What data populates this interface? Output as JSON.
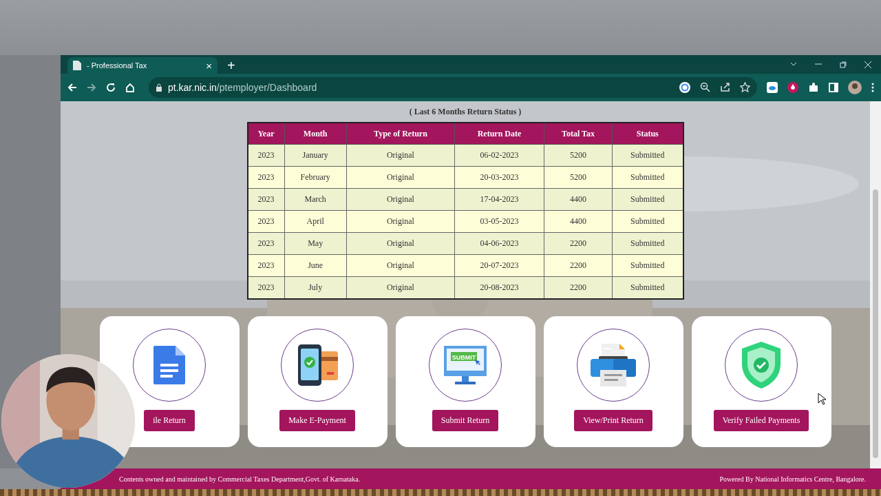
{
  "browser": {
    "tab": {
      "title": "- Professional Tax",
      "close": "×"
    },
    "new_tab": "+",
    "address": {
      "host": "pt.kar.nic.in",
      "path": "/ptemployer/Dashboard"
    }
  },
  "page": {
    "caption": "( Last 6 Months Return Status )",
    "table": {
      "columns": [
        "Year",
        "Month",
        "Type of Return",
        "Return Date",
        "Total Tax",
        "Status"
      ],
      "rows": [
        [
          "2023",
          "January",
          "Original",
          "06-02-2023",
          "5200",
          "Submitted"
        ],
        [
          "2023",
          "February",
          "Original",
          "20-03-2023",
          "5200",
          "Submitted"
        ],
        [
          "2023",
          "March",
          "Original",
          "17-04-2023",
          "4400",
          "Submitted"
        ],
        [
          "2023",
          "April",
          "Original",
          "03-05-2023",
          "4400",
          "Submitted"
        ],
        [
          "2023",
          "May",
          "Original",
          "04-06-2023",
          "2200",
          "Submitted"
        ],
        [
          "2023",
          "June",
          "Original",
          "20-07-2023",
          "2200",
          "Submitted"
        ],
        [
          "2023",
          "July",
          "Original",
          "20-08-2023",
          "2200",
          "Submitted"
        ]
      ]
    },
    "cards": [
      {
        "kind": "document",
        "button": "ile Return"
      },
      {
        "kind": "payment",
        "button": "Make E-Payment"
      },
      {
        "kind": "submit",
        "icon_label": "SUBMIT",
        "button": "Submit Return"
      },
      {
        "kind": "printer",
        "button": "View/Print Return"
      },
      {
        "kind": "shield",
        "button": "Verify Failed Payments"
      }
    ],
    "footer": {
      "left": "Contents owned and maintained by Commercial Taxes Department,Govt. of Karnataka.",
      "right": "Powered By National Informatics Centre, Bangalore."
    }
  }
}
